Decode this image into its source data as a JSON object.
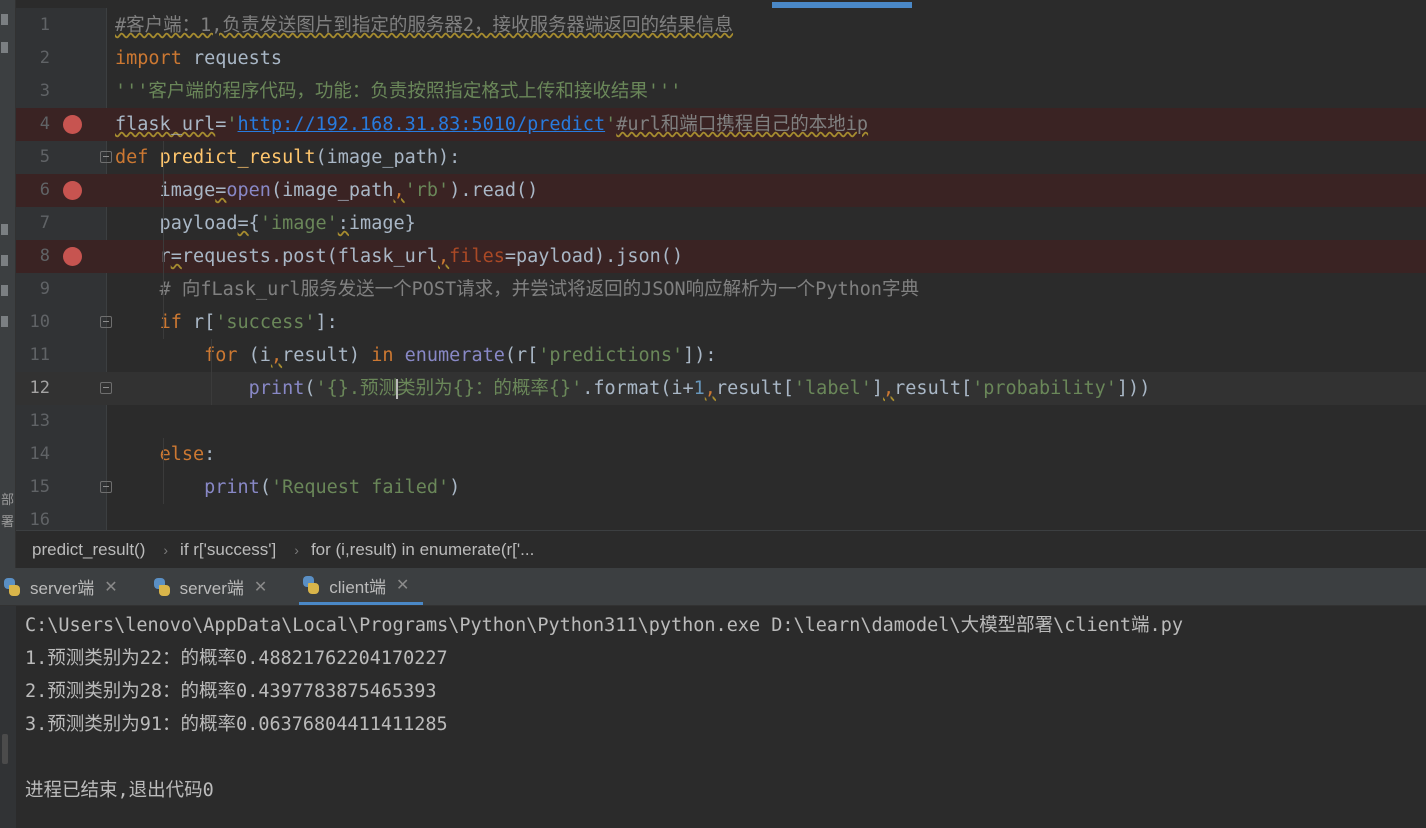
{
  "editor": {
    "lines": [
      {
        "n": "1",
        "parts": [
          {
            "t": "#客户端：1,负责发送图片到指定的服务器2，接收服务器端返回的结果信息",
            "c": "cm squig"
          }
        ]
      },
      {
        "n": "2",
        "parts": [
          {
            "t": "import",
            "c": "kw"
          },
          {
            "t": " requests",
            "c": ""
          }
        ]
      },
      {
        "n": "3",
        "parts": [
          {
            "t": "'''客户端的程序代码，功能：负责按照指定格式上传和接收结果'''",
            "c": "str"
          }
        ]
      },
      {
        "n": "4",
        "bp": true,
        "parts": [
          {
            "t": "flask_url",
            "c": "squig"
          },
          {
            "t": "=",
            "c": ""
          },
          {
            "t": "'",
            "c": "str"
          },
          {
            "t": "http://192.168.31.83:5010/predict",
            "c": "url"
          },
          {
            "t": "'",
            "c": "str"
          },
          {
            "t": "#url和端口携程自己的本地ip",
            "c": "cm squig"
          }
        ]
      },
      {
        "n": "5",
        "fold": true,
        "parts": [
          {
            "t": "def",
            "c": "kw"
          },
          {
            "t": " ",
            "c": ""
          },
          {
            "t": "predict_result",
            "c": "fn"
          },
          {
            "t": "(image_path):",
            "c": ""
          }
        ]
      },
      {
        "n": "6",
        "bp": true,
        "parts": [
          {
            "t": "    image",
            "c": ""
          },
          {
            "t": "=",
            "c": "squig"
          },
          {
            "t": "open",
            "c": "bi"
          },
          {
            "t": "(image_path",
            "c": ""
          },
          {
            "t": ",",
            "c": "kw squig"
          },
          {
            "t": "'rb'",
            "c": "str"
          },
          {
            "t": ").read()",
            "c": ""
          }
        ]
      },
      {
        "n": "7",
        "parts": [
          {
            "t": "    payload",
            "c": ""
          },
          {
            "t": "=",
            "c": "squig"
          },
          {
            "t": "{",
            "c": ""
          },
          {
            "t": "'image'",
            "c": "str"
          },
          {
            "t": ":",
            "c": "squig"
          },
          {
            "t": "image}",
            "c": ""
          }
        ]
      },
      {
        "n": "8",
        "bp": true,
        "parts": [
          {
            "t": "    r",
            "c": ""
          },
          {
            "t": "=",
            "c": "squig"
          },
          {
            "t": "requests.post(flask_url",
            "c": ""
          },
          {
            "t": ",",
            "c": "kw squig"
          },
          {
            "t": "files",
            "c": "kwarg"
          },
          {
            "t": "=payload).json()",
            "c": ""
          }
        ]
      },
      {
        "n": "9",
        "parts": [
          {
            "t": "    # 向fLask_url服务发送一个POST请求，并尝试将返回的JSON响应解析为一个Python字典",
            "c": "cm"
          }
        ]
      },
      {
        "n": "10",
        "fold": true,
        "parts": [
          {
            "t": "    ",
            "c": ""
          },
          {
            "t": "if",
            "c": "kw"
          },
          {
            "t": " r[",
            "c": ""
          },
          {
            "t": "'success'",
            "c": "str"
          },
          {
            "t": "]:",
            "c": ""
          }
        ]
      },
      {
        "n": "11",
        "parts": [
          {
            "t": "        ",
            "c": ""
          },
          {
            "t": "for",
            "c": "kw"
          },
          {
            "t": " (i",
            "c": ""
          },
          {
            "t": ",",
            "c": "kw squig"
          },
          {
            "t": "result) ",
            "c": ""
          },
          {
            "t": "in",
            "c": "kw"
          },
          {
            "t": " ",
            "c": ""
          },
          {
            "t": "enumerate",
            "c": "bi"
          },
          {
            "t": "(r[",
            "c": ""
          },
          {
            "t": "'predictions'",
            "c": "str"
          },
          {
            "t": "]):",
            "c": ""
          }
        ]
      },
      {
        "n": "12",
        "current": true,
        "fold": true,
        "parts": [
          {
            "t": "            ",
            "c": ""
          },
          {
            "t": "print",
            "c": "bi"
          },
          {
            "t": "(",
            "c": ""
          },
          {
            "t": "'{}.预测",
            "c": "str"
          },
          {
            "t": "|",
            "c": "cursor"
          },
          {
            "t": "类别为{}：的概率{}'",
            "c": "str"
          },
          {
            "t": ".format(i+",
            "c": ""
          },
          {
            "t": "1",
            "c": "num"
          },
          {
            "t": ",",
            "c": "kw squig"
          },
          {
            "t": "result[",
            "c": ""
          },
          {
            "t": "'label'",
            "c": "str"
          },
          {
            "t": "]",
            "c": ""
          },
          {
            "t": ",",
            "c": "kw squig"
          },
          {
            "t": "result[",
            "c": ""
          },
          {
            "t": "'probability'",
            "c": "str"
          },
          {
            "t": "]))",
            "c": ""
          }
        ]
      },
      {
        "n": "13",
        "parts": []
      },
      {
        "n": "14",
        "parts": [
          {
            "t": "    ",
            "c": ""
          },
          {
            "t": "else",
            "c": "kw"
          },
          {
            "t": ":",
            "c": ""
          }
        ]
      },
      {
        "n": "15",
        "fold": true,
        "parts": [
          {
            "t": "        ",
            "c": ""
          },
          {
            "t": "print",
            "c": "bi"
          },
          {
            "t": "(",
            "c": ""
          },
          {
            "t": "'Request failed'",
            "c": "str"
          },
          {
            "t": ")",
            "c": ""
          }
        ]
      },
      {
        "n": "16",
        "parts": []
      }
    ]
  },
  "breadcrumb": [
    "predict_result()",
    "if r['success']",
    "for (i,result) in enumerate(r['..."
  ],
  "run_tabs": [
    {
      "label": "server端",
      "active": false
    },
    {
      "label": "server端",
      "active": false
    },
    {
      "label": "client端",
      "active": true
    }
  ],
  "console": {
    "lines": [
      "C:\\Users\\lenovo\\AppData\\Local\\Programs\\Python\\Python311\\python.exe D:\\learn\\damodel\\大模型部署\\client端.py",
      "1.预测类别为22：的概率0.48821762204170227",
      "2.预测类别为28：的概率0.4397783875465393",
      "3.预测类别为91：的概率0.06376804411411285",
      "",
      "进程已结束,退出代码0"
    ]
  },
  "side_text": "部署",
  "colors": {
    "breakpoint": "#c75450",
    "accent": "#4a88c7",
    "keyword": "#cc7832",
    "string": "#6a8759",
    "comment": "#808080"
  }
}
